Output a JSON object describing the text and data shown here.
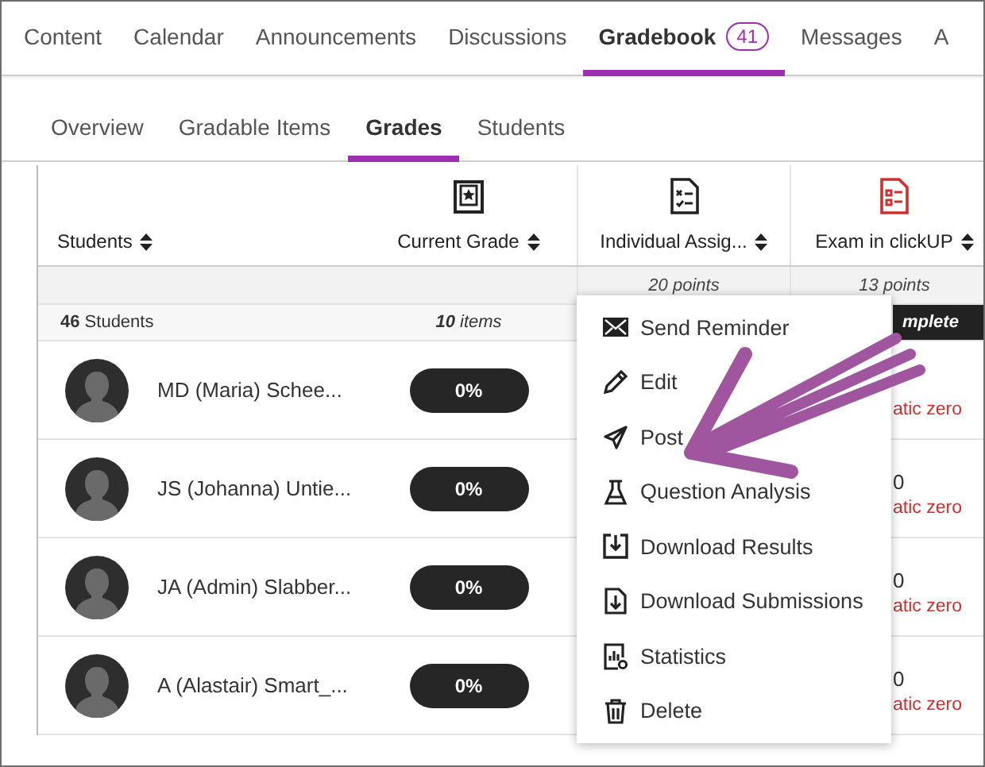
{
  "top_tabs": [
    {
      "label": "Content",
      "selected": false
    },
    {
      "label": "Calendar",
      "selected": false
    },
    {
      "label": "Announcements",
      "selected": false
    },
    {
      "label": "Discussions",
      "selected": false
    },
    {
      "label": "Gradebook",
      "badge": "41",
      "selected": true
    },
    {
      "label": "Messages",
      "selected": false
    },
    {
      "label": "A",
      "selected": false
    }
  ],
  "sub_tabs": [
    {
      "label": "Overview",
      "selected": false
    },
    {
      "label": "Gradable Items",
      "selected": false
    },
    {
      "label": "Grades",
      "selected": true
    },
    {
      "label": "Students",
      "selected": false
    }
  ],
  "table": {
    "columns": [
      {
        "label": "Students",
        "kind": "students"
      },
      {
        "label": "Current Grade",
        "kind": "grade"
      },
      {
        "label": "Individual Assig...",
        "kind": "assignment"
      },
      {
        "label": "Exam in clickUP",
        "kind": "exam"
      }
    ],
    "points": [
      "20 points",
      "13 points"
    ],
    "summary": {
      "count": "46",
      "count_label": "Students",
      "items_count": "10",
      "items_label": "items",
      "exam_status": "mplete"
    },
    "rows": [
      {
        "name": "MD (Maria) Schee...",
        "grade": "0%",
        "exam_note": "atic zero"
      },
      {
        "name": "JS (Johanna) Untie...",
        "grade": "0%",
        "exam_score": "0",
        "exam_note": "atic zero"
      },
      {
        "name": "JA (Admin) Slabber...",
        "grade": "0%",
        "exam_score": "0",
        "exam_note": "atic zero"
      },
      {
        "name": "A (Alastair) Smart_...",
        "grade": "0%",
        "exam_score": "0",
        "exam_note": "atic zero"
      }
    ]
  },
  "menu": [
    {
      "label": "Send Reminder",
      "kind": "mail"
    },
    {
      "label": "Edit",
      "kind": "edit"
    },
    {
      "label": "Post",
      "kind": "post"
    },
    {
      "label": "Question Analysis",
      "kind": "analysis"
    },
    {
      "label": "Download Results",
      "kind": "download"
    },
    {
      "label": "Download Submissions",
      "kind": "download-file"
    },
    {
      "label": "Statistics",
      "kind": "stats"
    },
    {
      "label": "Delete",
      "kind": "delete"
    }
  ]
}
